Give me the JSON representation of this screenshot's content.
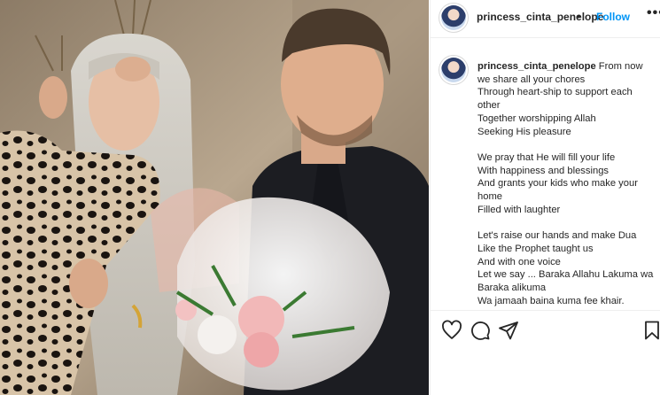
{
  "post": {
    "username": "princess_cinta_penelope",
    "separator": "•",
    "follow_label": "Follow",
    "more_label": "•••"
  },
  "caption": {
    "username": "princess_cinta_penelope",
    "first_line_text": "From now",
    "lines": [
      "we share all your chores",
      "Through heart-ship to support each",
      "other",
      "Together worshipping Allah",
      "Seeking His pleasure",
      "",
      "We pray that He will fill your life",
      "With happiness and blessings",
      "And grants your kids who make your",
      "home",
      "Filled with laughter",
      "",
      "Let's raise our hands and make Dua",
      "Like the Prophet taught us",
      "And with one voice",
      "Let we say ... Baraka Allahu Lakuma wa",
      "Baraka alikuma",
      "Wa jamaah baina kuma fee khair."
    ]
  },
  "actions": {
    "like_icon": "heart-icon",
    "comment_icon": "comment-icon",
    "share_icon": "paper-plane-icon",
    "save_icon": "bookmark-icon"
  },
  "colors": {
    "link_blue": "#0095f6",
    "text": "#262626",
    "border": "#efefef"
  }
}
